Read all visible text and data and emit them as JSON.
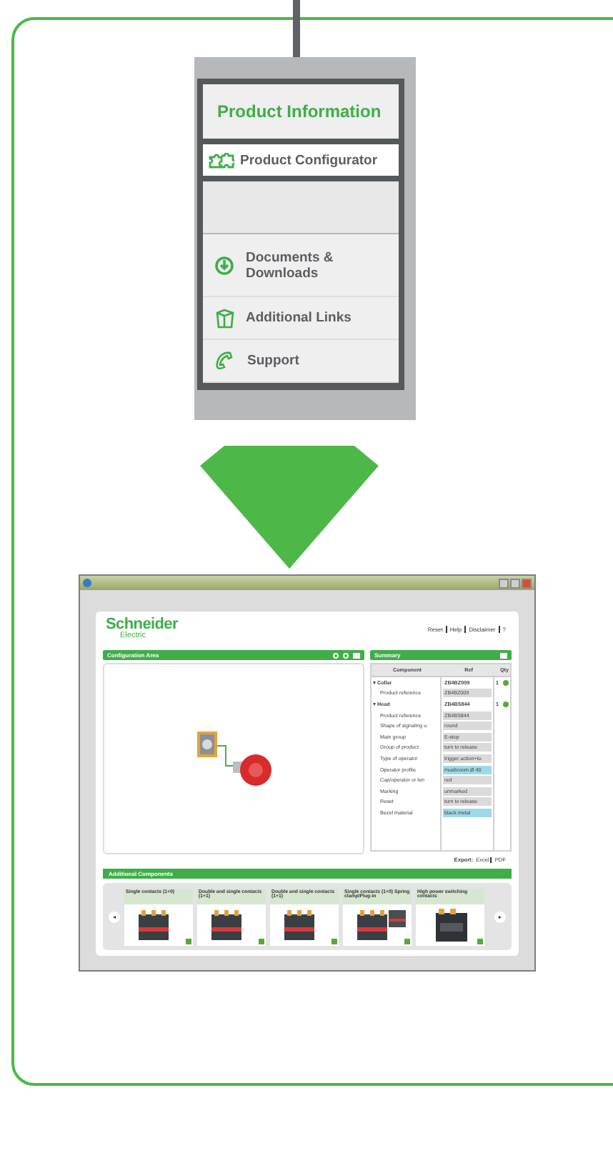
{
  "menu": {
    "header": "Product Information",
    "items": [
      {
        "label": "Product Configurator",
        "selected": true
      },
      {
        "label": "Documents & Downloads",
        "selected": false
      },
      {
        "label": "Additional Links",
        "selected": false
      },
      {
        "label": "Support",
        "selected": false
      }
    ]
  },
  "app": {
    "logo": {
      "name": "Schneider",
      "sub": "Electric"
    },
    "links": [
      "Reset",
      "Help",
      "Disclaimer",
      "?"
    ],
    "config_title": "Configuration Area",
    "summary": {
      "title": "Summary",
      "columns": [
        "Component",
        "Ref",
        "Qty"
      ],
      "rows": [
        {
          "component": "Collar",
          "ref": "ZB4BZ009",
          "qty": "1",
          "expanded": true,
          "children": [
            {
              "component": "Product reference",
              "ref": "ZB4BZ009",
              "highlighted": false
            }
          ]
        },
        {
          "component": "Head",
          "ref": "ZB4BS844",
          "qty": "1",
          "expanded": true,
          "children": [
            {
              "component": "Product reference",
              "ref": "ZB4BS844",
              "highlighted": false
            },
            {
              "component": "Shape of signaling u",
              "ref": "round",
              "highlighted": false
            },
            {
              "component": "Main group",
              "ref": "E-stop",
              "highlighted": false
            },
            {
              "component": "Group of product",
              "ref": "turn to release",
              "highlighted": false
            },
            {
              "component": "Type of operator",
              "ref": "trigger action+tu",
              "highlighted": false
            },
            {
              "component": "Operator profile",
              "ref": "mushroom Ø 40",
              "highlighted": true
            },
            {
              "component": "Cap/operator or len",
              "ref": "red",
              "highlighted": false
            },
            {
              "component": "Marking",
              "ref": "unmarked",
              "highlighted": false
            },
            {
              "component": "Reset",
              "ref": "turn to release",
              "highlighted": false
            },
            {
              "component": "Bezel material",
              "ref": "black metal",
              "highlighted": true
            }
          ]
        }
      ]
    },
    "export_label": "Export:",
    "export_links": [
      "Excel",
      "PDF"
    ],
    "additional": {
      "title": "Additional Components",
      "items": [
        {
          "label": "Single contacts (1+0)"
        },
        {
          "label": "Double and single contacts (1+1)"
        },
        {
          "label": "Double and single contacts (1+1)"
        },
        {
          "label": "Single contacts (1+0) Spring clamp/Plug-in"
        },
        {
          "label": "High power switching contacts"
        }
      ]
    }
  }
}
